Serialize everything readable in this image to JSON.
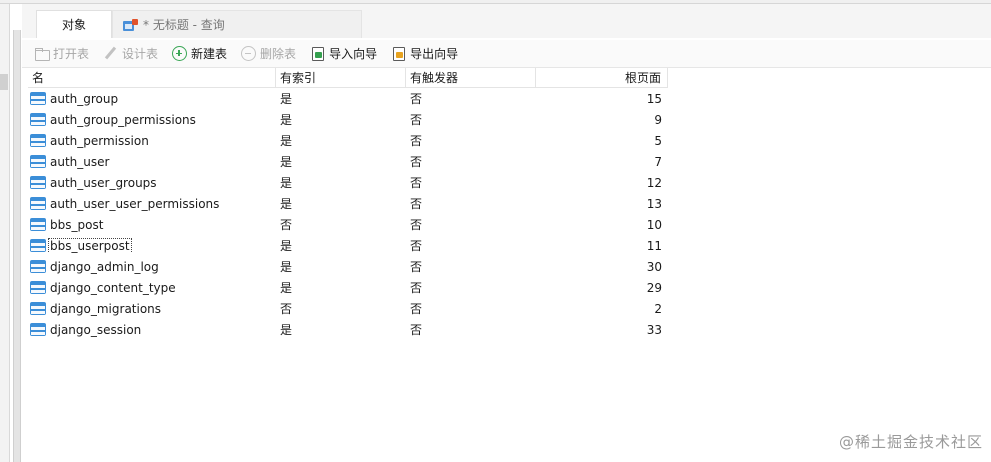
{
  "tabs": {
    "objects_label": "对象",
    "query_label": "* 无标题 - 查询"
  },
  "toolbar": {
    "open_table": "打开表",
    "design_table": "设计表",
    "new_table": "新建表",
    "delete_table": "删除表",
    "import_wizard": "导入向导",
    "export_wizard": "导出向导"
  },
  "table": {
    "headers": {
      "name": "名",
      "has_index": "有索引",
      "has_trigger": "有触发器",
      "root_pages": "根页面"
    },
    "rows": [
      {
        "name": "auth_group",
        "has_index": "是",
        "has_trigger": "否",
        "root_pages": "15"
      },
      {
        "name": "auth_group_permissions",
        "has_index": "是",
        "has_trigger": "否",
        "root_pages": "9"
      },
      {
        "name": "auth_permission",
        "has_index": "是",
        "has_trigger": "否",
        "root_pages": "5"
      },
      {
        "name": "auth_user",
        "has_index": "是",
        "has_trigger": "否",
        "root_pages": "7"
      },
      {
        "name": "auth_user_groups",
        "has_index": "是",
        "has_trigger": "否",
        "root_pages": "12"
      },
      {
        "name": "auth_user_user_permissions",
        "has_index": "是",
        "has_trigger": "否",
        "root_pages": "13"
      },
      {
        "name": "bbs_post",
        "has_index": "否",
        "has_trigger": "否",
        "root_pages": "10"
      },
      {
        "name": "bbs_userpost",
        "has_index": "是",
        "has_trigger": "否",
        "root_pages": "11"
      },
      {
        "name": "django_admin_log",
        "has_index": "是",
        "has_trigger": "否",
        "root_pages": "30"
      },
      {
        "name": "django_content_type",
        "has_index": "是",
        "has_trigger": "否",
        "root_pages": "29"
      },
      {
        "name": "django_migrations",
        "has_index": "否",
        "has_trigger": "否",
        "root_pages": "2"
      },
      {
        "name": "django_session",
        "has_index": "是",
        "has_trigger": "否",
        "root_pages": "33"
      }
    ]
  },
  "watermark": "@稀土掘金技术社区",
  "colors": {
    "table_icon": "#3b8ed8",
    "new_icon": "#3aa655",
    "import_icon": "#35a04f",
    "export_icon": "#e8a31f",
    "query_tab_icon_dot": "#e0522b"
  },
  "icons": {
    "open_table": "folder-icon",
    "design_table": "pencil-icon",
    "new_table": "plus-circle-icon",
    "delete_table": "minus-circle-icon",
    "import_wizard": "import-icon",
    "export_wizard": "export-icon",
    "row": "table-icon"
  }
}
